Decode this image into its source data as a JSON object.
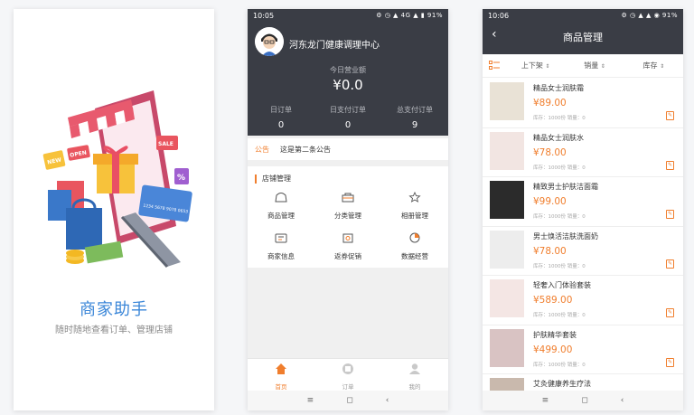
{
  "screen1": {
    "app_name": "商家助手",
    "tagline": "随时随地查看订单、管理店铺",
    "illus_new": "NEW",
    "illus_open": "OPEN",
    "illus_sale": "SALE",
    "illus_percent": "%",
    "illus_card": "1234 5678 9078 0653"
  },
  "screen2": {
    "status": {
      "time": "10:05",
      "indicators": "⚙ ◷ ▲ 4G ▲ ▮ 91%"
    },
    "store_name": "河东龙门健康调理中心",
    "today_label": "今日营业额",
    "today_value": "¥0.0",
    "stats": [
      {
        "label": "日订单",
        "value": "0"
      },
      {
        "label": "日支付订单",
        "value": "0"
      },
      {
        "label": "总支付订单",
        "value": "9"
      }
    ],
    "notice_tag": "公告",
    "notice_text": "这是第二条公告",
    "mgmt_title": "店铺管理",
    "menu": [
      {
        "label": "商品管理",
        "icon": "goods-icon"
      },
      {
        "label": "分类管理",
        "icon": "category-icon"
      },
      {
        "label": "相册管理",
        "icon": "album-icon"
      },
      {
        "label": "商家信息",
        "icon": "merchant-info-icon"
      },
      {
        "label": "返券促销",
        "icon": "coupon-icon"
      },
      {
        "label": "数据经营",
        "icon": "data-icon"
      }
    ],
    "tabs": [
      {
        "label": "首页",
        "icon": "home-icon"
      },
      {
        "label": "订单",
        "icon": "order-icon"
      },
      {
        "label": "我的",
        "icon": "user-icon"
      }
    ],
    "nav": {
      "menu": "≡",
      "home": "◻",
      "back": "‹"
    }
  },
  "screen3": {
    "status": {
      "time": "10:06",
      "indicators": "⚙ ◷ ▲ ▲ ◉ 91%"
    },
    "back": "‹",
    "title": "商品管理",
    "filters": [
      {
        "label": "上下架"
      },
      {
        "label": "销量"
      },
      {
        "label": "库存"
      }
    ],
    "sort_glyph": "⇕",
    "edit_glyph": "✎",
    "products": [
      {
        "name": "精品女士润肤霜",
        "price": "¥89.00",
        "stock": "库存：1000份  销量：0",
        "color": "#e9e2d6"
      },
      {
        "name": "精品女士润肤水",
        "price": "¥78.00",
        "stock": "库存：1000份  销量：0",
        "color": "#f2e5e2"
      },
      {
        "name": "精致男士护肤洁面霜",
        "price": "¥99.00",
        "stock": "库存：1000份  销量：0",
        "color": "#2b2b2b"
      },
      {
        "name": "男士焕活洁肤洗面奶",
        "price": "¥78.00",
        "stock": "库存：1000份  销量：0",
        "color": "#ededed"
      },
      {
        "name": "轻奢入门体验套装",
        "price": "¥589.00",
        "stock": "库存：1000份  销量：0",
        "color": "#f4e6e4"
      },
      {
        "name": "护肤精华套装",
        "price": "¥499.00",
        "stock": "库存：1000份  销量：0",
        "color": "#d9c3c3"
      },
      {
        "name": "艾灸健康养生疗法",
        "price": "",
        "stock": "",
        "color": "#c9b9ad"
      }
    ],
    "nav": {
      "menu": "≡",
      "home": "◻",
      "back": "‹"
    }
  },
  "colors": {
    "accent": "#f07e2d",
    "dark_header": "#3a3d45",
    "brand_blue": "#3a86d8"
  }
}
